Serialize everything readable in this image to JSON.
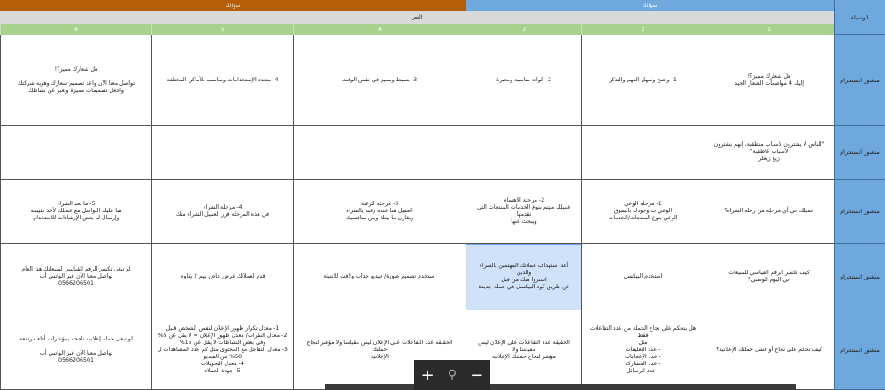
{
  "header": {
    "group_right": "سؤالك",
    "group_left": "سؤالك",
    "medium_label": "الوسيلة",
    "text_label": "النص",
    "column_numbers": [
      "1",
      "2",
      "3",
      "4",
      "5",
      "6"
    ]
  },
  "rows": [
    {
      "medium": "منشور انستجرام",
      "cells": [
        "هل شعارك مميز؟!\nإليك 4 مواصفات الشعار الجيد",
        "1- واضح وسهل الفهم والتذكر",
        "2- ألوانة مناسبة ومعبرة",
        "3- بسيط ومميز في نفس الوقت",
        "4- متعدد الإستخدامات ومناسب للأماكن المختلفة",
        "هل شعارك مميز؟!\n\nتواصل معنا الآن واعد تصميم شعارك وهوية شركتك\nواجعل تصميمات مميزة وتعبر عن نشاطك"
      ]
    },
    {
      "medium": "منشور انستجرام",
      "cells": [
        "\"الناس لا يشترون لأسباب منطقية، إنهم يشترون لأسباب عاطفية\"\nزيغ زيغلر",
        "",
        "",
        "",
        "",
        ""
      ]
    },
    {
      "medium": "منشور انستجرام",
      "cells": [
        "عميلك في أي مرحلة من رحلة الشراء؟",
        "1- مرحلة الوعي\nالوعي ب وجودك بالسوق\nالوعي بنوع المنتجات/الخدمات",
        "2- مرحلة الاهتمام\nعميلك مهتم بنوع الخدمات المنتجات التي تقدمها\nويبحث عنها",
        "3- مرحلة الرغبة\nالعميل هنا عنده رغبة بالشراء\nويقارن ما بينك وبين منافسيك",
        "4- مرحلة الشراء\nفي هذه المرحلة قرر العميل الشراء منك",
        "5- ما بعد الشراء\nهنا عليك التواصل مع عميلك لأخذ تقييمه\nوإرسال له بعض الإرشادات للاستخدام"
      ]
    },
    {
      "medium": "منشور انستجرام",
      "cells": [
        "كيف تكسر الرقم القياسي للمبيعات\nفي اليوم الوطني؟",
        "استخدم البيكسل",
        "أعد استهداف عملائك المهتمين بالشراء والذين\nاشتروا منك من قبل\nعن طريق كود البيكسل في حملة جديدة",
        "استخدم تصميم صورة/ فيديو جذاب ولافت للانتباه",
        "قدم لعملائك عرض خاص بهم لا يقاوم",
        "لو تبغى تكسر الرقم القياسي لمبيعاتك هذا العام\nتواصل معنا الآن عبر الواتس أب\n0566206501"
      ]
    },
    {
      "medium": "منشور انستجرام",
      "cells": [
        "كيف تحكم على نجاح أو فشل حملتك الإعلانية؟",
        "هل يتحكم على نجاح الحملة من عدد التفاعلات فقط\nمثل\n- عدد التعليقات\n- عدد الإعجابات\n- عدد المشاركة\n- عدد الرسائل",
        "الحقيقة عدد التفاعلات على الإعلان ليس مقياسا ولا\nمؤشر لنجاح حملتك الإعلانية",
        "الحقيقة عدد التفاعلات على الإعلان ليس مقياسا ولا مؤشر لنجاح حملتك\nالإعلانية",
        "1- معدل تكرار ظهور الإعلان لنفس الشخص قليل\n2- معدل النقرات/ معدل ظهور الإعلان = لا يقل عن 5% وفي بعض النشاطات لا يقل عن 15%\n3- معدل التفاعل مع المحتوى مثل كم عدد المشاهدات ل 50% من الفيديو\n4- معدل التحويلات\n5- جودة العملاء",
        "لو تبغى حملة إعلانية ناجحة بمؤشرات أداء مرتفعة\n\nتواصل معنا الآن عبر الواتس أب\n0566206501"
      ]
    }
  ],
  "zoom": {
    "plus": "+",
    "search": "⚲",
    "minus": "−"
  },
  "colors": {
    "blue": "#6fa8dc",
    "orange": "#b45f06",
    "green": "#a9d18e",
    "gray": "#d9d9d9"
  }
}
